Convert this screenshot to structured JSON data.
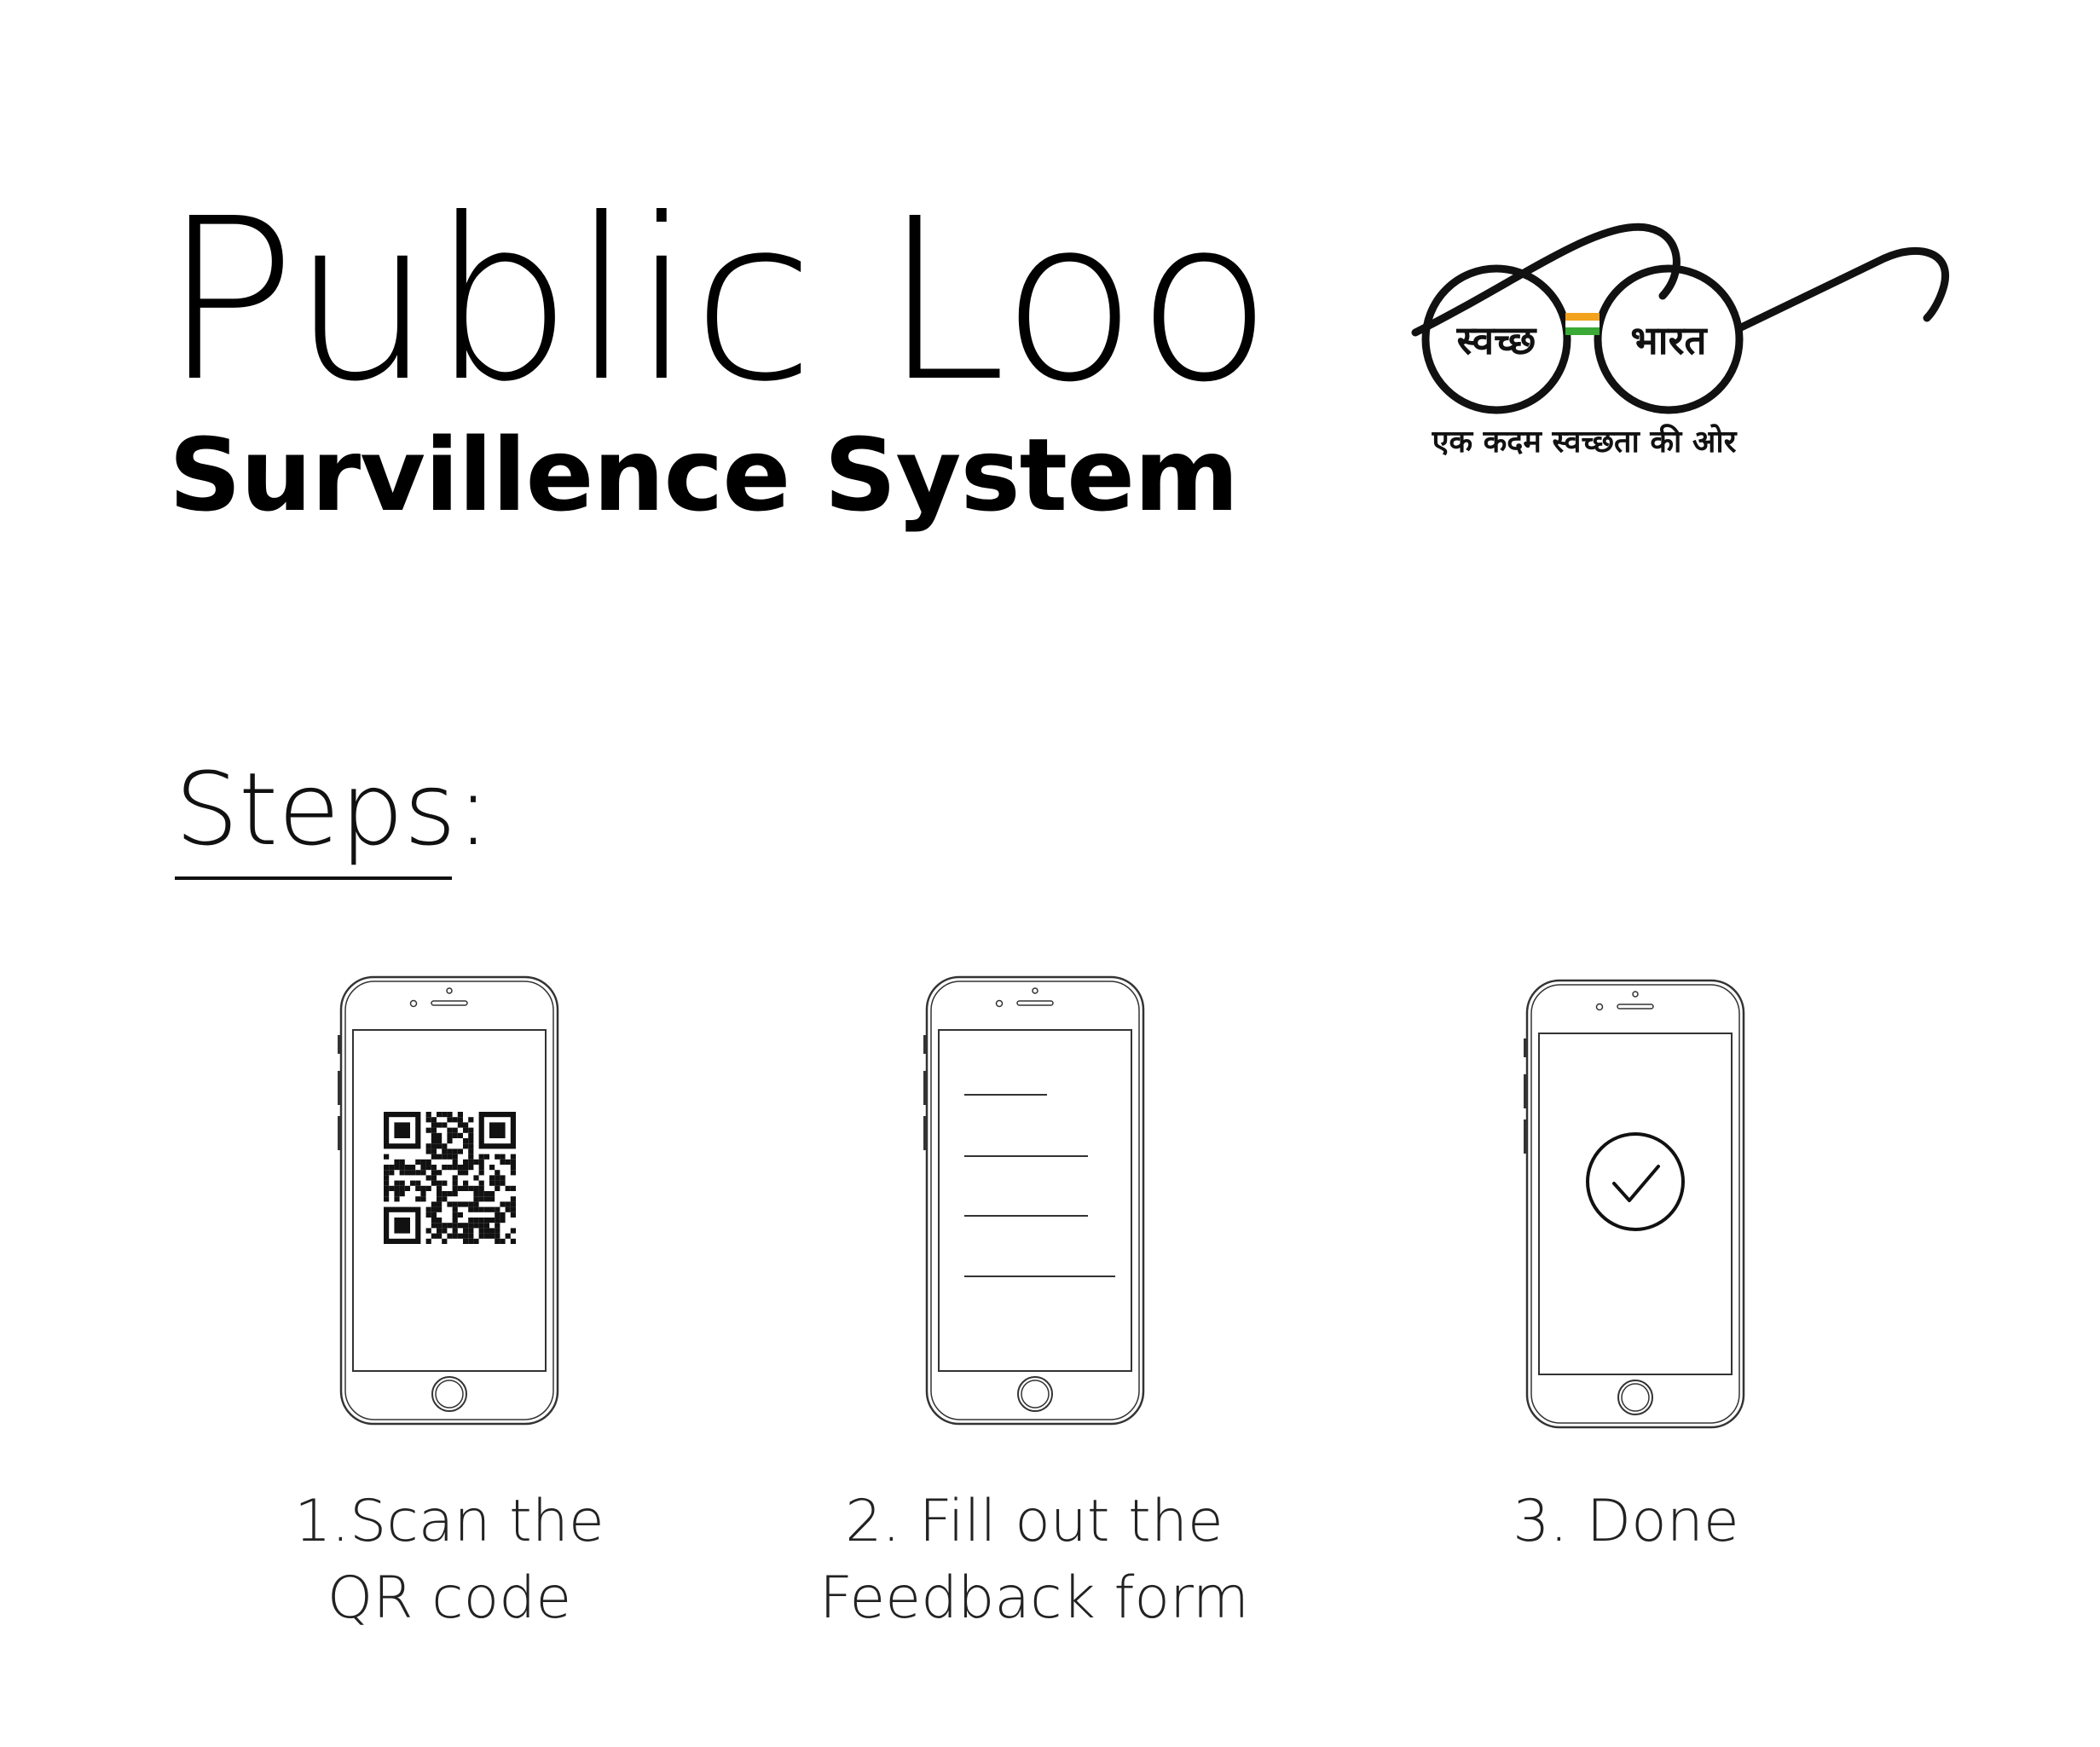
{
  "header": {
    "title": "Public Loo",
    "subtitle": "Survillence System"
  },
  "logo": {
    "left_lens_text": "स्वच्छ",
    "right_lens_text": "भारत",
    "tagline": "एक कदम स्वच्छता की ओर",
    "colors": {
      "saffron": "#F2A21D",
      "white": "#FFFFFF",
      "green": "#3AA935",
      "frame": "#111111"
    }
  },
  "steps": {
    "heading": "Steps:",
    "items": [
      {
        "line1": "1.Scan the",
        "line2": "QR code",
        "screen": "qr-code"
      },
      {
        "line1": "2. Fill out the",
        "line2": "Feedback form",
        "screen": "form-lines"
      },
      {
        "line1": "3. Done",
        "line2": "",
        "screen": "check-circle"
      }
    ]
  }
}
